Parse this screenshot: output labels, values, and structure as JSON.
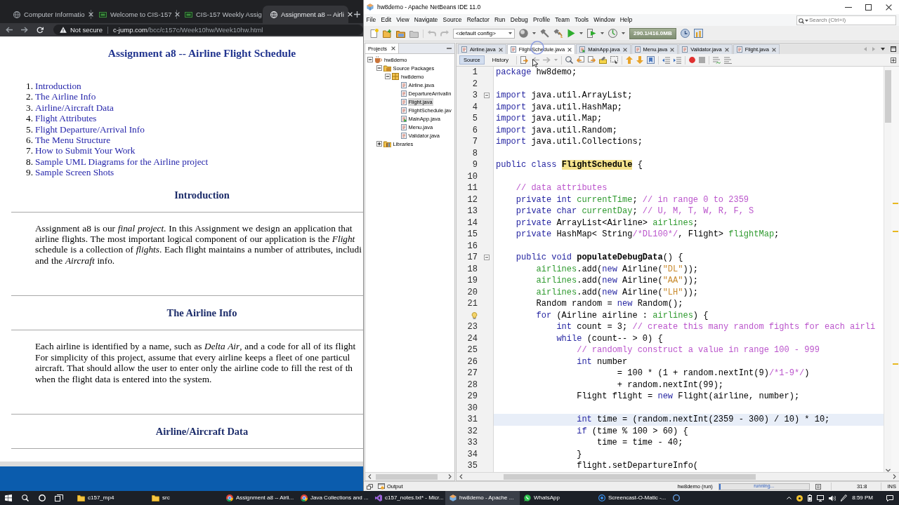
{
  "browser": {
    "tabs": [
      {
        "title": "Computer Informatio",
        "kind": "globe",
        "selected": false
      },
      {
        "title": "Welcome to CIS-157",
        "kind": "course",
        "selected": false
      },
      {
        "title": "CIS-157 Weekly Assig",
        "kind": "course",
        "selected": false
      },
      {
        "title": "Assignment a8 -- Airli",
        "kind": "globe",
        "selected": true
      }
    ],
    "address": {
      "security": "Not secure",
      "host": "c-jump.com",
      "path": "/bcc/c157c/Week10hw/Week10hw.html"
    },
    "page": {
      "title": "Assignment a8 -- Airline Flight Schedule",
      "contents": [
        {
          "number": "1.",
          "text": "Introduction"
        },
        {
          "number": "2.",
          "text": "The Airline Info"
        },
        {
          "number": "3.",
          "text": "Airline/Aircraft Data"
        },
        {
          "number": "4.",
          "text": "Flight Attributes"
        },
        {
          "number": "5.",
          "text": "Flight Departure/Arrival Info"
        },
        {
          "number": "6.",
          "text": "The Menu Structure"
        },
        {
          "number": "7.",
          "text": "How to Submit Your Work"
        },
        {
          "number": "8.",
          "text": "Sample UML Diagrams for the Airline project"
        },
        {
          "number": "9.",
          "text": "Sample Screen Shots"
        }
      ],
      "sections": [
        {
          "heading": "Introduction",
          "lines": [
            "Assignment a8 is our *final project*. In this Assignment we design an application that",
            "airline flights. The most important logical component of our application is the *Flight*",
            "schedule is a collection of *flights*. Each flight maintains a number of attributes, includi",
            "and the *Aircraft* info."
          ]
        },
        {
          "heading": "The Airline Info",
          "lines": [
            "Each airline is identified by a name, such as *Delta Air*, and a code for all of its flight",
            "For simplicity of this project, assume that every airline keeps a fleet of one particul",
            "aircraft. That should allow the user to enter only the airline code to fill the rest of th",
            "when the flight data is entered into the system."
          ]
        },
        {
          "heading": "Airline/Aircraft Data"
        }
      ]
    }
  },
  "ide": {
    "title": "hw8demo - Apache NetBeans IDE 11.0",
    "menu": [
      "File",
      "Edit",
      "View",
      "Navigate",
      "Source",
      "Refactor",
      "Run",
      "Debug",
      "Profile",
      "Team",
      "Tools",
      "Window",
      "Help"
    ],
    "search": {
      "placeholder": "Search (Ctrl+I)"
    },
    "toolbar": {
      "config": "<default config>",
      "memory": "290.1/416.0MB"
    },
    "projects": {
      "title": "Projects",
      "tree": [
        {
          "label": "hw8demo",
          "kind": "project",
          "expanded": true,
          "selected": false,
          "children": [
            {
              "label": "Source Packages",
              "kind": "sources",
              "expanded": true,
              "selected": false,
              "children": [
                {
                  "label": "hw8demo",
                  "kind": "package",
                  "expanded": true,
                  "selected": false,
                  "children": [
                    {
                      "label": "Airline.java",
                      "kind": "class",
                      "selected": false
                    },
                    {
                      "label": "DepartureArrivalIn",
                      "kind": "class",
                      "selected": false
                    },
                    {
                      "label": "Flight.java",
                      "kind": "class",
                      "selected": true
                    },
                    {
                      "label": "FlightSchedule.jav",
                      "kind": "class",
                      "selected": false
                    },
                    {
                      "label": "MainApp.java",
                      "kind": "main",
                      "selected": false
                    },
                    {
                      "label": "Menu.java",
                      "kind": "class",
                      "selected": false
                    },
                    {
                      "label": "Validator.java",
                      "kind": "class",
                      "selected": false
                    }
                  ]
                }
              ]
            },
            {
              "label": "Libraries",
              "kind": "libraries",
              "expanded": false,
              "selected": false
            }
          ]
        }
      ]
    },
    "editor": {
      "tabs": [
        {
          "label": "Airline.java",
          "kind": "class",
          "selected": false
        },
        {
          "label": "FlightSchedule.java",
          "kind": "class",
          "selected": true
        },
        {
          "label": "MainApp.java",
          "kind": "main",
          "selected": false
        },
        {
          "label": "Menu.java",
          "kind": "class",
          "selected": false
        },
        {
          "label": "Validator.java",
          "kind": "class",
          "selected": false
        },
        {
          "label": "Flight.java",
          "kind": "class",
          "selected": false
        }
      ],
      "views": [
        {
          "label": "Source",
          "selected": true
        },
        {
          "label": "History",
          "selected": false
        }
      ],
      "lines": [
        {
          "number": "1",
          "hint": false,
          "fold": false,
          "current": false,
          "code": [
            {
              "kind": "keyword",
              "text": "package"
            },
            {
              "kind": "plain",
              "text": " hw8demo;"
            }
          ]
        },
        {
          "number": "2",
          "hint": false,
          "fold": false,
          "current": false
        },
        {
          "number": "3",
          "hint": false,
          "fold": true,
          "current": false,
          "code": [
            {
              "kind": "keyword",
              "text": "import"
            },
            {
              "kind": "plain",
              "text": " java.util.ArrayList;"
            }
          ]
        },
        {
          "number": "4",
          "hint": false,
          "fold": false,
          "current": false,
          "code": [
            {
              "kind": "keyword",
              "text": "import"
            },
            {
              "kind": "plain",
              "text": " java.util.HashMap;"
            }
          ]
        },
        {
          "number": "5",
          "hint": false,
          "fold": false,
          "current": false,
          "code": [
            {
              "kind": "keyword",
              "text": "import"
            },
            {
              "kind": "plain",
              "text": " java.util.Map;"
            }
          ]
        },
        {
          "number": "6",
          "hint": false,
          "fold": false,
          "current": false,
          "code": [
            {
              "kind": "keyword",
              "text": "import"
            },
            {
              "kind": "plain",
              "text": " java.util.Random;"
            }
          ]
        },
        {
          "number": "7",
          "hint": false,
          "fold": false,
          "current": false,
          "code": [
            {
              "kind": "keyword",
              "text": "import"
            },
            {
              "kind": "plain",
              "text": " java.util.Collections;"
            }
          ]
        },
        {
          "number": "8",
          "hint": false,
          "fold": false,
          "current": false
        },
        {
          "number": "9",
          "hint": false,
          "fold": false,
          "current": false,
          "code": [
            {
              "kind": "keyword",
              "text": "public class "
            },
            {
              "kind": "mark",
              "text": "FlightSchedule"
            },
            {
              "kind": "plain",
              "text": " {"
            }
          ]
        },
        {
          "number": "10",
          "hint": false,
          "fold": false,
          "current": false
        },
        {
          "number": "11",
          "hint": false,
          "fold": false,
          "current": false,
          "code": [
            {
              "kind": "comment",
              "text": "    // data attributes"
            }
          ]
        },
        {
          "number": "12",
          "hint": false,
          "fold": false,
          "current": false,
          "code": [
            {
              "kind": "keyword",
              "text": "    private int "
            },
            {
              "kind": "field",
              "text": "currentTime"
            },
            {
              "kind": "plain",
              "text": "; "
            },
            {
              "kind": "comment",
              "text": "// in range 0 to 2359"
            }
          ]
        },
        {
          "number": "13",
          "hint": false,
          "fold": false,
          "current": false,
          "code": [
            {
              "kind": "keyword",
              "text": "    private char "
            },
            {
              "kind": "field",
              "text": "currentDay"
            },
            {
              "kind": "plain",
              "text": "; "
            },
            {
              "kind": "comment",
              "text": "// U, M, T, W, R, F, S"
            }
          ]
        },
        {
          "number": "14",
          "hint": false,
          "fold": false,
          "current": false,
          "code": [
            {
              "kind": "keyword",
              "text": "    private "
            },
            {
              "kind": "plain",
              "text": "ArrayList<Airline> "
            },
            {
              "kind": "field",
              "text": "airlines"
            },
            {
              "kind": "plain",
              "text": ";"
            }
          ]
        },
        {
          "number": "15",
          "hint": false,
          "fold": false,
          "current": false,
          "code": [
            {
              "kind": "keyword",
              "text": "    private "
            },
            {
              "kind": "plain",
              "text": "HashMap< String"
            },
            {
              "kind": "comment",
              "text": "/*DL100*/"
            },
            {
              "kind": "plain",
              "text": ", Flight> "
            },
            {
              "kind": "field",
              "text": "flightMap"
            },
            {
              "kind": "plain",
              "text": ";"
            }
          ]
        },
        {
          "number": "16",
          "hint": false,
          "fold": false,
          "current": false
        },
        {
          "number": "17",
          "hint": false,
          "fold": true,
          "current": false,
          "code": [
            {
              "kind": "keyword",
              "text": "    public void "
            },
            {
              "kind": "method",
              "text": "populateDebugData"
            },
            {
              "kind": "plain",
              "text": "() {"
            }
          ]
        },
        {
          "number": "18",
          "hint": false,
          "fold": false,
          "current": false,
          "code": [
            {
              "kind": "field",
              "text": "        airlines"
            },
            {
              "kind": "plain",
              "text": ".add("
            },
            {
              "kind": "keyword",
              "text": "new "
            },
            {
              "kind": "plain",
              "text": "Airline("
            },
            {
              "kind": "string",
              "text": "\"DL\""
            },
            {
              "kind": "plain",
              "text": "));"
            }
          ]
        },
        {
          "number": "19",
          "hint": false,
          "fold": false,
          "current": false,
          "code": [
            {
              "kind": "field",
              "text": "        airlines"
            },
            {
              "kind": "plain",
              "text": ".add("
            },
            {
              "kind": "keyword",
              "text": "new "
            },
            {
              "kind": "plain",
              "text": "Airline("
            },
            {
              "kind": "string",
              "text": "\"AA\""
            },
            {
              "kind": "plain",
              "text": "));"
            }
          ]
        },
        {
          "number": "20",
          "hint": false,
          "fold": false,
          "current": false,
          "code": [
            {
              "kind": "field",
              "text": "        airlines"
            },
            {
              "kind": "plain",
              "text": ".add("
            },
            {
              "kind": "keyword",
              "text": "new "
            },
            {
              "kind": "plain",
              "text": "Airline("
            },
            {
              "kind": "string",
              "text": "\"LH\""
            },
            {
              "kind": "plain",
              "text": "));"
            }
          ]
        },
        {
          "number": "21",
          "hint": false,
          "fold": false,
          "current": false,
          "code": [
            {
              "kind": "plain",
              "text": "        Random random = "
            },
            {
              "kind": "keyword",
              "text": "new "
            },
            {
              "kind": "plain",
              "text": "Random();"
            }
          ]
        },
        {
          "hint": true,
          "fold": false,
          "current": false,
          "code": [
            {
              "kind": "keyword",
              "text": "        for "
            },
            {
              "kind": "plain",
              "text": "(Airline airline : "
            },
            {
              "kind": "field",
              "text": "airlines"
            },
            {
              "kind": "plain",
              "text": ") {"
            }
          ]
        },
        {
          "number": "23",
          "hint": false,
          "fold": false,
          "current": false,
          "code": [
            {
              "kind": "keyword",
              "text": "            int "
            },
            {
              "kind": "plain",
              "text": "count = 3; "
            },
            {
              "kind": "comment",
              "text": "// create this many random fights for each airli"
            }
          ]
        },
        {
          "number": "24",
          "hint": false,
          "fold": false,
          "current": false,
          "code": [
            {
              "kind": "keyword",
              "text": "            while "
            },
            {
              "kind": "plain",
              "text": "(count-- > 0) {"
            }
          ]
        },
        {
          "number": "25",
          "hint": false,
          "fold": false,
          "current": false,
          "code": [
            {
              "kind": "comment",
              "text": "                // randomly construct a value in range 100 - 999"
            }
          ]
        },
        {
          "number": "26",
          "hint": false,
          "fold": false,
          "current": false,
          "code": [
            {
              "kind": "keyword",
              "text": "                int "
            },
            {
              "kind": "plain",
              "text": "number"
            }
          ]
        },
        {
          "number": "27",
          "hint": false,
          "fold": false,
          "current": false,
          "code": [
            {
              "kind": "plain",
              "text": "                        = 100 * (1 + random.nextInt(9)"
            },
            {
              "kind": "comment",
              "text": "/*1-9*/"
            },
            {
              "kind": "plain",
              "text": ")"
            }
          ]
        },
        {
          "number": "28",
          "hint": false,
          "fold": false,
          "current": false,
          "code": [
            {
              "kind": "plain",
              "text": "                        + random.nextInt(99);"
            }
          ]
        },
        {
          "number": "29",
          "hint": false,
          "fold": false,
          "current": false,
          "code": [
            {
              "kind": "plain",
              "text": "                Flight flight = "
            },
            {
              "kind": "keyword",
              "text": "new "
            },
            {
              "kind": "plain",
              "text": "Flight(airline, number);"
            }
          ]
        },
        {
          "number": "30",
          "hint": false,
          "fold": false,
          "current": false
        },
        {
          "number": "31",
          "hint": false,
          "fold": false,
          "current": true,
          "code": [
            {
              "kind": "keyword",
              "text": "                int "
            },
            {
              "kind": "plain",
              "text": "time = (random.nextInt(2359 - 300) / 10) * 10;"
            }
          ]
        },
        {
          "number": "32",
          "hint": false,
          "fold": false,
          "current": false,
          "code": [
            {
              "kind": "keyword",
              "text": "                if "
            },
            {
              "kind": "plain",
              "text": "(time % 100 > 60) {"
            }
          ]
        },
        {
          "number": "33",
          "hint": false,
          "fold": false,
          "current": false,
          "code": [
            {
              "kind": "plain",
              "text": "                    time = time - 40;"
            }
          ]
        },
        {
          "number": "34",
          "hint": false,
          "fold": false,
          "current": false,
          "code": [
            {
              "kind": "plain",
              "text": "                }"
            }
          ]
        },
        {
          "number": "35",
          "hint": false,
          "fold": false,
          "current": false,
          "code": [
            {
              "kind": "plain",
              "text": "                flight.setDepartureInfo("
            }
          ]
        }
      ]
    },
    "output": {
      "label": "Output"
    },
    "status": {
      "task": "hw8demo (run)",
      "progress": {
        "label": "running...",
        "level": 0.02
      },
      "position": "31:8",
      "mode": "INS"
    }
  },
  "taskbar": {
    "apps": [
      {
        "label": "c157_mp4",
        "kind": "folder",
        "active": false
      },
      {
        "label": "src",
        "kind": "folder",
        "active": false
      },
      {
        "label": "Assignment a8 -- Airli...",
        "kind": "browser",
        "active": false
      },
      {
        "label": "Java Collections and ...",
        "kind": "browser",
        "active": false
      },
      {
        "label": "c157_notes.txt* - Micr...",
        "kind": "editor",
        "active": false
      },
      {
        "label": "hw8demo - Apache ...",
        "kind": "ide",
        "active": true
      },
      {
        "label": "WhatsApp",
        "kind": "chat",
        "active": false
      },
      {
        "label": "Screencast-O-Matic -...",
        "kind": "recorder",
        "active": false
      },
      {
        "kind": "capture",
        "active": false
      }
    ],
    "clock": "8:59 PM"
  }
}
